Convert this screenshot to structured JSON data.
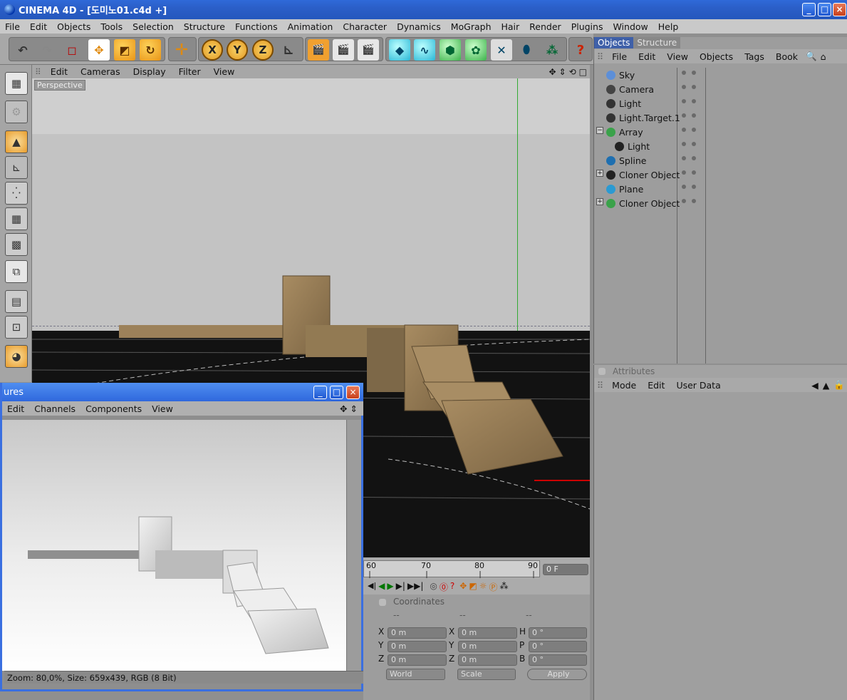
{
  "window": {
    "title": "CINEMA 4D - [도미노01.c4d +]",
    "minimize": "_",
    "maximize": "□",
    "close": "×"
  },
  "menu": [
    "File",
    "Edit",
    "Objects",
    "Tools",
    "Selection",
    "Structure",
    "Functions",
    "Animation",
    "Character",
    "Dynamics",
    "MoGraph",
    "Hair",
    "Render",
    "Plugins",
    "Window",
    "Help"
  ],
  "toolbar": {
    "x_label": "X",
    "y_label": "Y",
    "z_label": "Z",
    "help_label": "?"
  },
  "viewport": {
    "menu": [
      "Edit",
      "Cameras",
      "Display",
      "Filter",
      "View"
    ],
    "label": "Perspective"
  },
  "objects_panel": {
    "tabs": [
      "Objects",
      "Structure"
    ],
    "menu": [
      "File",
      "Edit",
      "View",
      "Objects",
      "Tags",
      "Book"
    ],
    "items": [
      {
        "name": "Sky",
        "indent": 0
      },
      {
        "name": "Camera",
        "indent": 0
      },
      {
        "name": "Light",
        "indent": 0
      },
      {
        "name": "Light.Target.1",
        "indent": 0
      },
      {
        "name": "Array",
        "indent": 0,
        "expander": "−"
      },
      {
        "name": "Light",
        "indent": 1
      },
      {
        "name": "Spline",
        "indent": 0
      },
      {
        "name": "Cloner Object",
        "indent": 0,
        "expander": "+"
      },
      {
        "name": "Plane",
        "indent": 0
      },
      {
        "name": "Cloner Object",
        "indent": 0,
        "expander": "+"
      }
    ]
  },
  "attributes_panel": {
    "title": "Attributes",
    "menu": [
      "Mode",
      "Edit",
      "User Data"
    ]
  },
  "picture_viewer": {
    "title": "ures",
    "menu": [
      "Edit",
      "Channels",
      "Components",
      "View"
    ],
    "status": "Zoom: 80,0%, Size: 659x439, RGB (8 Bit)"
  },
  "timeline": {
    "ticks": [
      "60",
      "70",
      "80",
      "90"
    ],
    "frame": "0 F"
  },
  "coordinates": {
    "title": "Coordinates",
    "dashes": [
      "--",
      "--",
      "--"
    ],
    "pos": [
      {
        "axis": "X",
        "value": "0 m"
      },
      {
        "axis": "Y",
        "value": "0 m"
      },
      {
        "axis": "Z",
        "value": "0 m"
      }
    ],
    "size": [
      {
        "axis": "X",
        "value": "0 m"
      },
      {
        "axis": "Y",
        "value": "0 m"
      },
      {
        "axis": "Z",
        "value": "0 m"
      }
    ],
    "rot": [
      {
        "axis": "H",
        "value": "0 °"
      },
      {
        "axis": "P",
        "value": "0 °"
      },
      {
        "axis": "B",
        "value": "0 °"
      }
    ],
    "mode1": "World",
    "mode2": "Scale",
    "apply": "Apply"
  }
}
